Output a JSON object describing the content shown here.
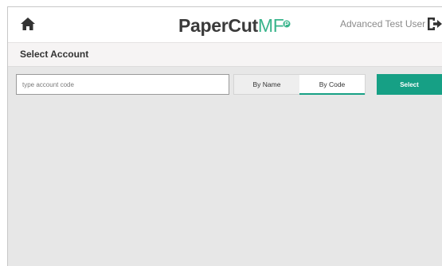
{
  "header": {
    "logo_main": "PaperCut",
    "logo_suffix": "MF",
    "user_name": "Advanced Test User",
    "home_icon": "home-icon",
    "logout_icon": "logout-icon"
  },
  "title_bar": {
    "title": "Select Account"
  },
  "account_search": {
    "value": "",
    "placeholder": "type account code"
  },
  "mode_toggle": {
    "options": [
      {
        "label": "By Name",
        "selected": false
      },
      {
        "label": "By Code",
        "selected": true
      }
    ]
  },
  "actions": {
    "select_label": "Select"
  },
  "colors": {
    "accent": "#16a085",
    "brand_green": "#38b48b",
    "content_bg": "#e7e7e7"
  }
}
